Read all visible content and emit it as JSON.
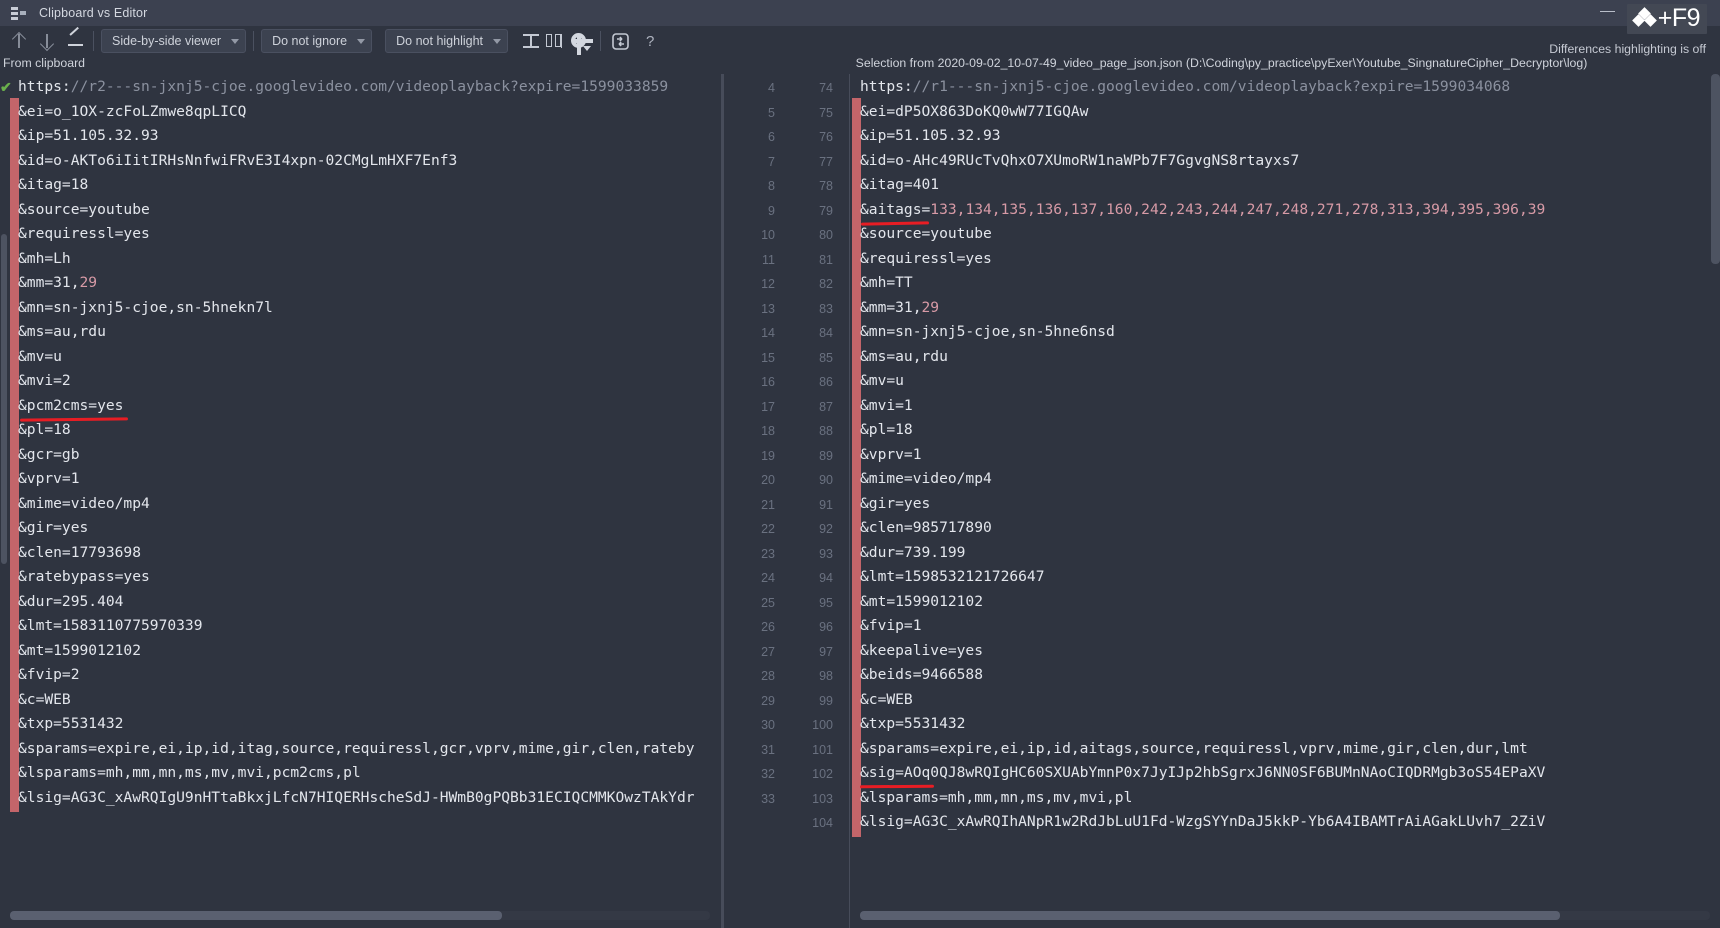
{
  "window": {
    "title": "Clipboard vs Editor",
    "icon": "diff-window-icon",
    "minimize_label": "—",
    "maximize_label": "❐",
    "close_label": "×"
  },
  "shortcut_overlay": {
    "modifier_icon": "jetbrains-diamonds-icon",
    "key_label": "+F9"
  },
  "toolbar": {
    "prev_difference": "arrow-up-icon",
    "next_difference": "arrow-down-icon",
    "edit_source": "pencil-icon",
    "viewer_mode": "Side-by-side viewer",
    "ignore_policy": "Do not ignore",
    "highlight_policy": "Do not highlight",
    "collapse_unchanged": "collapse-unchanged-icon",
    "synchronize_scroll": "two-columns-resize-icon",
    "settings": "gear-icon",
    "swap_sides": "swap-sides-icon",
    "help": "?"
  },
  "status": {
    "highlighting_message": "Differences highlighting is off"
  },
  "panels": {
    "left": {
      "header": "From clipboard",
      "first_line_marker": "✔",
      "lines": [
        {
          "text": "https://r2---sn-jxnj5-cjoe.googlevideo.com/videoplayback?expire=1599033859",
          "segments": [
            {
              "t": "https:",
              "c": "plain"
            },
            {
              "t": "//r2---sn-jxnj5-cjoe.googlevideo.com/videoplayback?expire=1599033859",
              "c": "dim"
            }
          ]
        },
        {
          "text": "&ei=o_1OX-zcFoLZmwe8qpLICQ"
        },
        {
          "text": "&ip=51.105.32.93"
        },
        {
          "text": "&id=o-AKTo6iIitIRHsNnfwiFRvE3I4xpn-02CMgLmHXF7Enf3"
        },
        {
          "text": "&itag=18"
        },
        {
          "text": "&source=youtube"
        },
        {
          "text": "&requiressl=yes"
        },
        {
          "text": "&mh=Lh"
        },
        {
          "text": "&mm=31,29",
          "segments": [
            {
              "t": "&mm=31,",
              "c": "plain"
            },
            {
              "t": "29",
              "c": "num"
            }
          ]
        },
        {
          "text": "&mn=sn-jxnj5-cjoe,sn-5hnekn7l"
        },
        {
          "text": "&ms=au,rdu"
        },
        {
          "text": "&mv=u"
        },
        {
          "text": "&mvi=2"
        },
        {
          "text": "&pcm2cms=yes",
          "annotated": true
        },
        {
          "text": "&pl=18"
        },
        {
          "text": "&gcr=gb"
        },
        {
          "text": "&vprv=1"
        },
        {
          "text": "&mime=video/mp4"
        },
        {
          "text": "&gir=yes"
        },
        {
          "text": "&clen=17793698"
        },
        {
          "text": "&ratebypass=yes"
        },
        {
          "text": "&dur=295.404"
        },
        {
          "text": "&lmt=1583110775970339"
        },
        {
          "text": "&mt=1599012102"
        },
        {
          "text": "&fvip=2"
        },
        {
          "text": "&c=WEB"
        },
        {
          "text": "&txp=5531432"
        },
        {
          "text": "&sparams=expire,ei,ip,id,itag,source,requiressl,gcr,vprv,mime,gir,clen,rateby"
        },
        {
          "text": "&lsparams=mh,mm,mn,ms,mv,mvi,pcm2cms,pl"
        },
        {
          "text": "&lsig=AG3C_xAwRQIgU9nHTtaBkxjLfcN7HIQERHscheSdJ-HWmB0gPQBb31ECIQCMMKOwzTAkYdr"
        }
      ]
    },
    "right": {
      "header": "Selection from 2020-09-02_10-07-49_video_page_json.json (D:\\Coding\\py_practice\\pyExer\\Youtube_SingnatureCipher_Decryptor\\log)",
      "gutter_a": [
        "4",
        "5",
        "6",
        "7",
        "8",
        "9",
        "10",
        "11",
        "12",
        "13",
        "14",
        "15",
        "16",
        "17",
        "18",
        "19",
        "20",
        "21",
        "22",
        "23",
        "24",
        "25",
        "26",
        "27",
        "28",
        "29",
        "30",
        "31",
        "32",
        "33",
        ""
      ],
      "gutter_b": [
        "74",
        "75",
        "76",
        "77",
        "78",
        "79",
        "80",
        "81",
        "82",
        "83",
        "84",
        "85",
        "86",
        "87",
        "88",
        "89",
        "90",
        "91",
        "92",
        "93",
        "94",
        "95",
        "96",
        "97",
        "98",
        "99",
        "100",
        "101",
        "102",
        "103",
        "104"
      ],
      "current_line_index": 0,
      "lines": [
        {
          "text": "https://r1---sn-jxnj5-cjoe.googlevideo.com/videoplayback?expire=1599034068",
          "segments": [
            {
              "t": "https:",
              "c": "plain"
            },
            {
              "t": "//r1---sn-jxnj5-cjoe.googlevideo.com/videoplayback?expire=1599034068",
              "c": "dim"
            }
          ]
        },
        {
          "text": "&ei=dP5OX863DoKQ0wW77IGQAw"
        },
        {
          "text": "&ip=51.105.32.93"
        },
        {
          "text": "&id=o-AHc49RUcTvQhxO7XUmoRW1naWPb7F7GgvgNS8rtayxs7"
        },
        {
          "text": "&itag=401"
        },
        {
          "text": "&aitags=133,134,135,136,137,160,242,243,244,247,248,271,278,313,394,395,396,39",
          "annotated": true,
          "segments": [
            {
              "t": "&aitags=",
              "c": "plain"
            },
            {
              "t": "133,134,135,136,137,160,242,243,244,247,248,271,278,313,394,395,396,39",
              "c": "num"
            }
          ]
        },
        {
          "text": "&source=youtube"
        },
        {
          "text": "&requiressl=yes"
        },
        {
          "text": "&mh=TT"
        },
        {
          "text": "&mm=31,29",
          "segments": [
            {
              "t": "&mm=31,",
              "c": "plain"
            },
            {
              "t": "29",
              "c": "num"
            }
          ]
        },
        {
          "text": "&mn=sn-jxnj5-cjoe,sn-5hne6nsd"
        },
        {
          "text": "&ms=au,rdu"
        },
        {
          "text": "&mv=u"
        },
        {
          "text": "&mvi=1"
        },
        {
          "text": "&pl=18"
        },
        {
          "text": "&vprv=1"
        },
        {
          "text": "&mime=video/mp4"
        },
        {
          "text": "&gir=yes"
        },
        {
          "text": "&clen=985717890"
        },
        {
          "text": "&dur=739.199"
        },
        {
          "text": "&lmt=1598532121726647"
        },
        {
          "text": "&mt=1599012102"
        },
        {
          "text": "&fvip=1"
        },
        {
          "text": "&keepalive=yes"
        },
        {
          "text": "&beids=9466588"
        },
        {
          "text": "&c=WEB"
        },
        {
          "text": "&txp=5531432"
        },
        {
          "text": "&sparams=expire,ei,ip,id,aitags,source,requiressl,vprv,mime,gir,clen,dur,lmt"
        },
        {
          "text": "&sig=AOq0QJ8wRQIgHC60SXUAbYmnP0x7JyIJp2hbSgrxJ6NN0SF6BUMnNAoCIQDRMgb3oS54EPaXV",
          "annotated": true
        },
        {
          "text": "&lsparams=mh,mm,mn,ms,mv,mvi,pl"
        },
        {
          "text": "&lsig=AG3C_xAwRQIhANpR1w2RdJbLuU1Fd-WzgSYYnDaJ5kkP-Yb6A4IBAMTrAiAGakLUvh7_2ZiV"
        }
      ]
    }
  },
  "colors": {
    "background": "#2f3440",
    "chrome": "#3c4150",
    "change_marker": "#c3656a",
    "annotation_red": "#e81d24",
    "text": "#e3e6ec",
    "dim_text": "#8b919f",
    "number_literal": "#d79aa6",
    "check_green": "#6ab04c"
  }
}
